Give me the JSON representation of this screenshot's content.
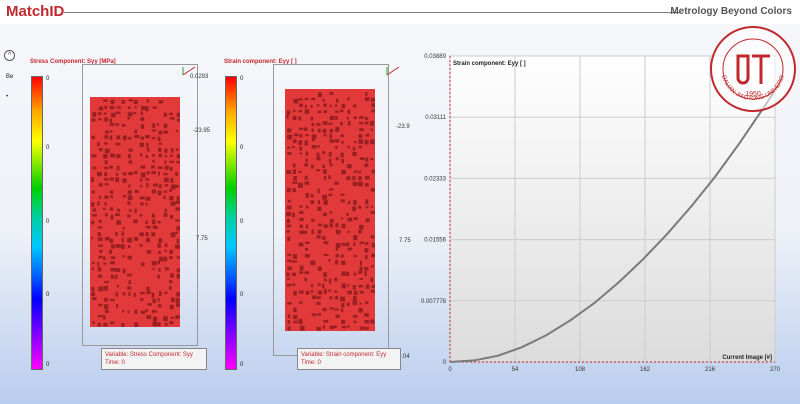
{
  "header": {
    "brand": "MatchID",
    "tagline": "Metrology Beyond Colors"
  },
  "left_strip": {
    "label_top": "Be",
    "label_dot": "•",
    "collapse_icon": "^"
  },
  "stress_panel": {
    "title": "Stress Component: Syy [MPa]",
    "colorbar_labels": [
      "0",
      "0",
      "0",
      "0",
      "0"
    ],
    "axis_top": "0.0293",
    "axis_labels": [
      "-23.95",
      "7.75"
    ],
    "info_variable": "Variable: Stress Component: Syy",
    "info_time": "Time: 0"
  },
  "strain_panel": {
    "title": "Strain component: Eyy [ ]",
    "colorbar_labels": [
      "0",
      "0",
      "0",
      "0",
      "0"
    ],
    "axis_labels": [
      "-23.9",
      "7.75"
    ],
    "axis_bottom": "-0.04",
    "info_variable": "Variable: Strain component: Eyy",
    "info_time": "Time: 0"
  },
  "colors": {
    "brand": "#c0282d",
    "specimen": "#e23a3a",
    "curve": "#7a7a7a",
    "grid": "#cccccc"
  },
  "chart_data": {
    "type": "line",
    "title": "Strain component: Eyy [ ]",
    "xlabel": "Current Image [#]",
    "ylabel": "",
    "xlim": [
      0,
      270
    ],
    "ylim": [
      0,
      0.03889
    ],
    "x_ticks": [
      "0",
      "54",
      "108",
      "162",
      "216",
      "270"
    ],
    "y_ticks": [
      "0",
      "0.007778",
      "0.01556",
      "0.02333",
      "0.03111",
      "0.03889"
    ],
    "grid": true,
    "series": [
      {
        "x": [
          0,
          20,
          40,
          60,
          80,
          100,
          120,
          140,
          160,
          180,
          200,
          220,
          240,
          260,
          270
        ],
        "y": [
          0.0,
          0.0002,
          0.0008,
          0.0019,
          0.0034,
          0.0053,
          0.0075,
          0.0101,
          0.013,
          0.0162,
          0.0197,
          0.0235,
          0.0277,
          0.0322,
          0.0345
        ]
      }
    ]
  }
}
